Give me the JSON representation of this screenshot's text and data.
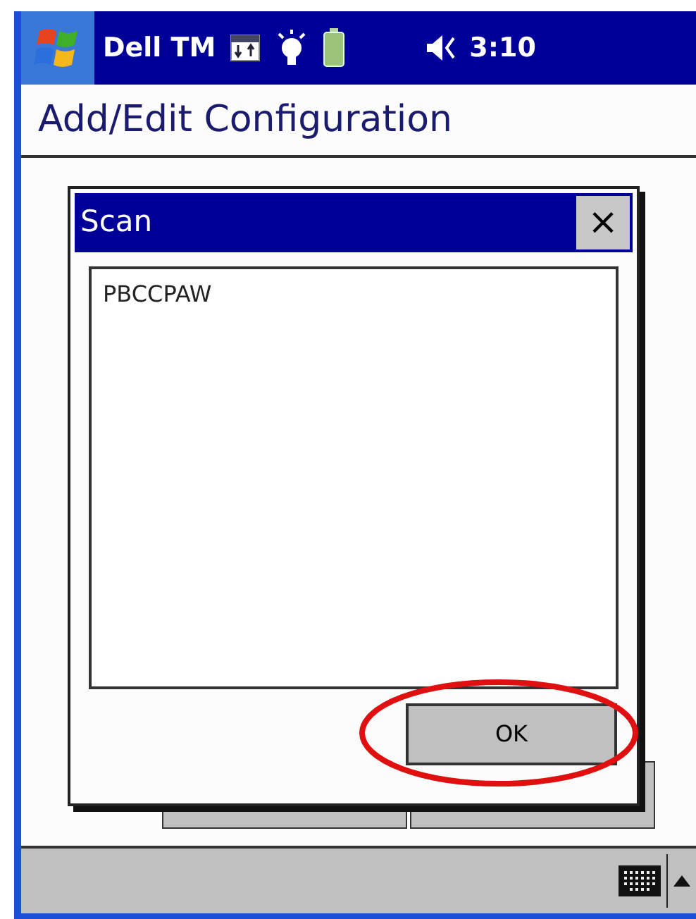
{
  "status_bar": {
    "app_title": "Dell TM",
    "time": "3:10"
  },
  "page_title": "Add/Edit Configuration",
  "dialog": {
    "title": "Scan",
    "close": "×",
    "scanned_text": "PBCCPAW",
    "ok_label": "OK",
    "ok_highlighted": true
  }
}
